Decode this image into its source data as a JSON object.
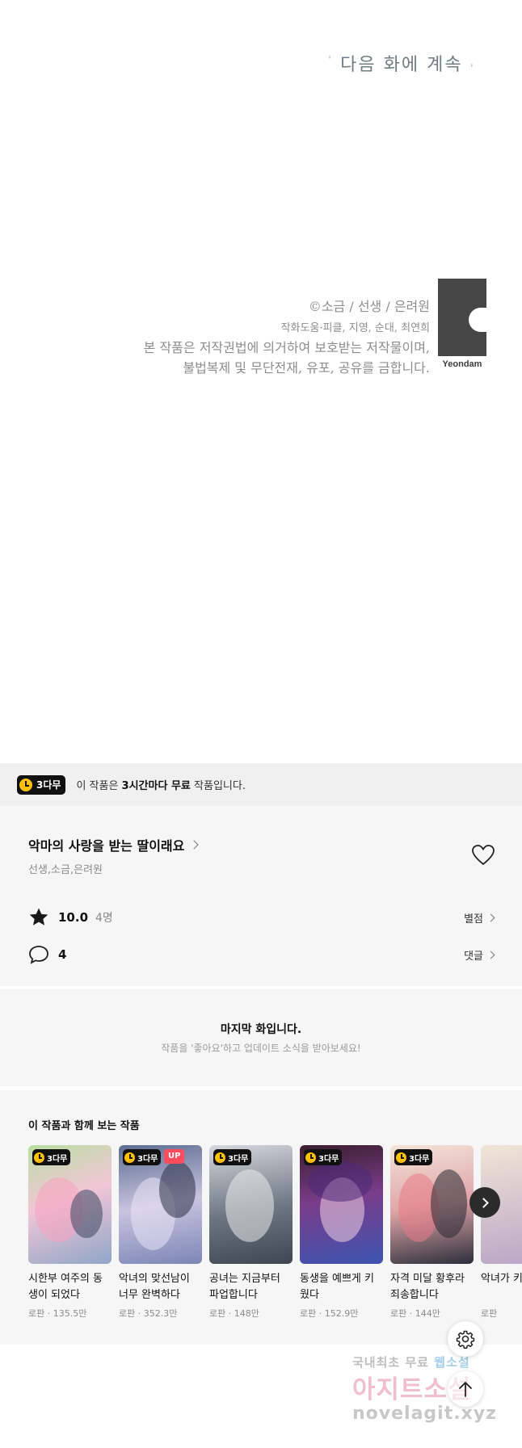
{
  "comic": {
    "continue_text": "다음 화에 계속",
    "credits": {
      "copyright": "©소금 / 선생 / 은려원",
      "assist": "작화도움·피클, 지영, 순대, 최연희",
      "notice_line1": "본 작품은 저작권법에 의거하여 보호받는 저작물이며,",
      "notice_line2": "불법복제 및 무단전재, 유포, 공유를 금합니다."
    },
    "publisher_logo_text": "Yeondam"
  },
  "free_banner": {
    "badge": "3다무",
    "text_prefix": "이 작품은 ",
    "text_bold": "3시간마다 무료",
    "text_suffix": " 작품입니다."
  },
  "work": {
    "title": "악마의 사랑을 받는 딸이래요",
    "authors": "선생,소금,은려원",
    "rating": "10.0",
    "rating_count": "4명",
    "rating_link": "별점",
    "comment_count": "4",
    "comment_link": "댓글"
  },
  "last_episode": {
    "title": "마지막 화입니다.",
    "subtitle": "작품을 '좋아요'하고 업데이트 소식을 받아보세요!"
  },
  "recommendations": {
    "heading": "이 작품과 함께 보는 작품",
    "items": [
      {
        "title": "시한부 여주의 동생이 되었다",
        "meta": "로판 · 135.5만",
        "badge": "3다무",
        "up": ""
      },
      {
        "title": "악녀의 맞선남이 너무 완벽하다",
        "meta": "로판 · 352.3만",
        "badge": "3다무",
        "up": "UP"
      },
      {
        "title": "공녀는 지금부터 파업합니다",
        "meta": "로판 · 148만",
        "badge": "3다무",
        "up": ""
      },
      {
        "title": "동생을 예쁘게 키웠다",
        "meta": "로판 · 152.9만",
        "badge": "3다무",
        "up": ""
      },
      {
        "title": "자격 미달 황후라 죄송합니다",
        "meta": "로판 · 144만",
        "badge": "3다무",
        "up": ""
      },
      {
        "title": "악녀가 키웠다",
        "meta": "로판",
        "badge": "",
        "up": ""
      }
    ]
  },
  "watermark": {
    "line1_a": "국내최초 무료",
    "line1_b": "웹소설",
    "line2": "아지트소설",
    "line3": "novelagit.xyz"
  },
  "colors": {
    "accent_yellow": "#ffc100",
    "up_badge": "#ff4b5c",
    "panel_bg": "#f6f6f6",
    "banner_bg": "#f0f0f0"
  }
}
